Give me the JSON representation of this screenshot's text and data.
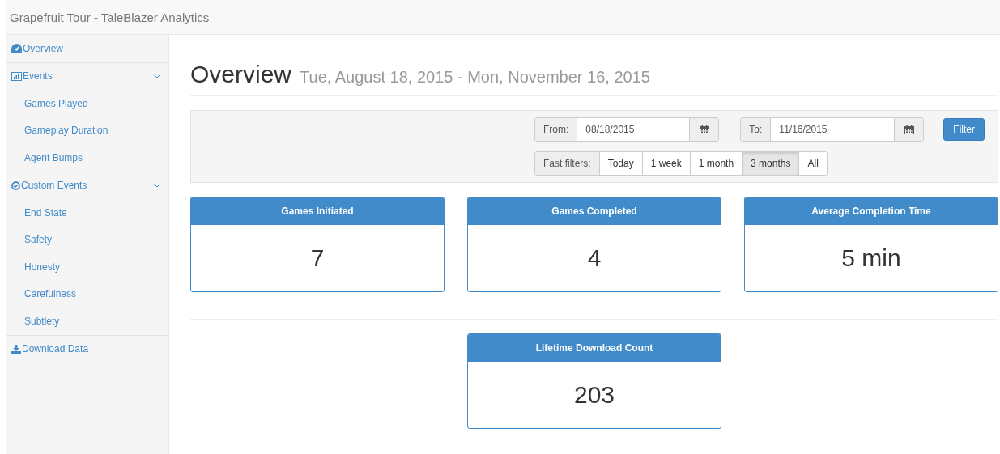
{
  "navbar": {
    "title": "Grapefruit Tour - TaleBlazer Analytics"
  },
  "sidebar": {
    "items": [
      {
        "label": "Overview",
        "selected": true
      },
      {
        "label": "Events",
        "selected": false,
        "expanded": true,
        "children": [
          {
            "label": "Games Played",
            "selected": false
          },
          {
            "label": "Gameplay Duration",
            "selected": false
          },
          {
            "label": "Agent Bumps",
            "selected": false
          }
        ]
      },
      {
        "label": "Custom Events",
        "selected": false,
        "expanded": true,
        "children": [
          {
            "label": "End State",
            "selected": false
          },
          {
            "label": "Safety",
            "selected": false
          },
          {
            "label": "Honesty",
            "selected": false
          },
          {
            "label": "Carefulness",
            "selected": false
          },
          {
            "label": "Subtlety",
            "selected": false
          }
        ]
      },
      {
        "label": "Download Data",
        "selected": false
      }
    ]
  },
  "header": {
    "title": "Overview",
    "subtitle": "Tue, August 18, 2015 - Mon, November 16, 2015"
  },
  "filter": {
    "from_label": "From:",
    "from_value": "08/18/2015",
    "to_label": "To:",
    "to_value": "11/16/2015",
    "button": "Filter",
    "fast_label": "Fast filters:",
    "fast_filters": [
      {
        "label": "Today",
        "selected": false
      },
      {
        "label": "1 week",
        "selected": false
      },
      {
        "label": "1 month",
        "selected": false
      },
      {
        "label": "3 months",
        "selected": true
      },
      {
        "label": "All",
        "selected": false
      }
    ]
  },
  "stats": [
    {
      "title": "Games Initiated",
      "value": "7"
    },
    {
      "title": "Games Completed",
      "value": "4"
    },
    {
      "title": "Average Completion Time",
      "value": "5 min"
    }
  ],
  "lifetime": {
    "title": "Lifetime Download Count",
    "value": "203"
  }
}
